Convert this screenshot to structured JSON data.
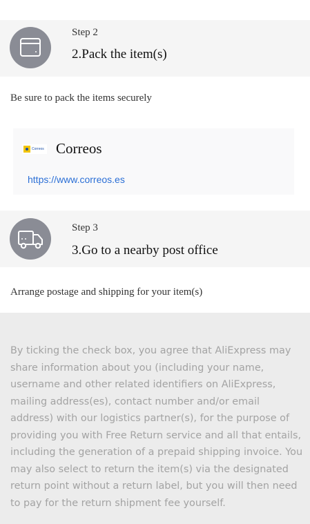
{
  "steps": [
    {
      "step_label": "Step 2",
      "title": "2.Pack the item(s)",
      "icon": "package-box-icon",
      "description": "Be sure to pack the items securely"
    },
    {
      "step_label": "Step 3",
      "title": "3.Go to a nearby post office",
      "icon": "delivery-truck-icon",
      "description": "Arrange postage and shipping for your item(s)"
    }
  ],
  "carrier": {
    "name": "Correos",
    "url": "https://www.correos.es",
    "logo_text": "Correos",
    "logo_colors": {
      "yellow": "#f2c400",
      "blue": "#1b4fa8"
    }
  },
  "consent": {
    "text": "By ticking the check box, you agree that AliExpress may share information about you (including your name, username and other related identifiers on AliExpress, mailing address(es), contact number and/or email address) with our logistics partner(s), for the purpose of providing you with Free Return service and all that entails, including the generation of a prepaid shipping invoice. You may also select to return the item(s) via the designated return point without a return label, but you will then need to pay for the return shipment fee yourself."
  },
  "colors": {
    "step_header_bg": "#f5f5f5",
    "icon_circle": "#8a8c95",
    "link": "#2b6fd6",
    "consent_bg": "#ececec",
    "consent_text": "#a3a3a3"
  }
}
